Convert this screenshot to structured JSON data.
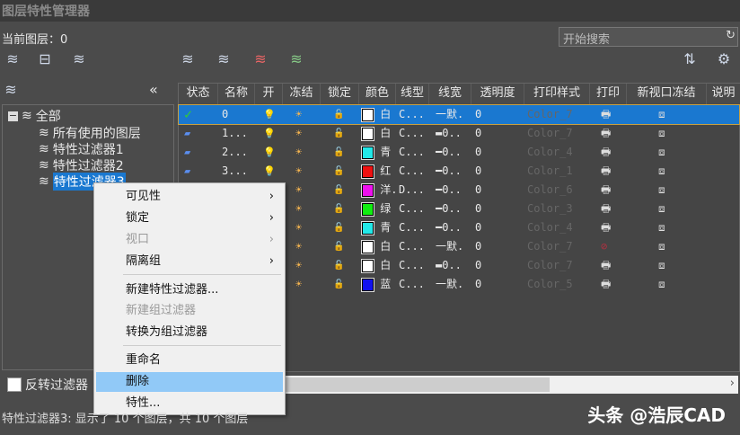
{
  "title": "图层特性管理器",
  "current_layer": "当前图层：0",
  "search": {
    "placeholder": "开始搜索"
  },
  "tree": {
    "root": "全部",
    "items": [
      "所有使用的图层",
      "特性过滤器1",
      "特性过滤器2",
      "特性过滤器3"
    ],
    "selected": "特性过滤器3"
  },
  "columns": [
    "状态",
    "名称",
    "开",
    "冻结",
    "锁定",
    "颜色",
    "线型",
    "线宽",
    "透明度",
    "打印样式",
    "打印",
    "新视口冻结",
    "说明"
  ],
  "rows": [
    {
      "name": "0",
      "color": "#ffffff",
      "color_name": "白",
      "linetype": "C...",
      "lineweight": "一默.",
      "transparency": "0",
      "plotstyle": "Color_7",
      "plot": true
    },
    {
      "name": "1...",
      "color": "#ffffff",
      "color_name": "白",
      "linetype": "C...",
      "lineweight": "▬0..",
      "transparency": "0",
      "plotstyle": "Color_7",
      "plot": true
    },
    {
      "name": "2...",
      "color": "#22e8e8",
      "color_name": "青",
      "linetype": "C...",
      "lineweight": "━0..",
      "transparency": "0",
      "plotstyle": "Color_4",
      "plot": true
    },
    {
      "name": "3...",
      "color": "#ee1111",
      "color_name": "红",
      "linetype": "C...",
      "lineweight": "━0..",
      "transparency": "0",
      "plotstyle": "Color_1",
      "plot": true
    },
    {
      "name": "",
      "color": "#ee11ee",
      "color_name": "洋.",
      "linetype": "D...",
      "lineweight": "━0..",
      "transparency": "0",
      "plotstyle": "Color_6",
      "plot": true
    },
    {
      "name": "",
      "color": "#11ee11",
      "color_name": "绿",
      "linetype": "C...",
      "lineweight": "━0..",
      "transparency": "0",
      "plotstyle": "Color_3",
      "plot": true
    },
    {
      "name": "",
      "color": "#22e8e8",
      "color_name": "青",
      "linetype": "C...",
      "lineweight": "━0..",
      "transparency": "0",
      "plotstyle": "Color_4",
      "plot": true
    },
    {
      "name": "",
      "color": "#ffffff",
      "color_name": "白",
      "linetype": "C...",
      "lineweight": "一默.",
      "transparency": "0",
      "plotstyle": "Color_7",
      "plot": false
    },
    {
      "name": "",
      "color": "#ffffff",
      "color_name": "白",
      "linetype": "C...",
      "lineweight": "▬0..",
      "transparency": "0",
      "plotstyle": "Color_7",
      "plot": true
    },
    {
      "name": "",
      "color": "#1111ee",
      "color_name": "蓝",
      "linetype": "C...",
      "lineweight": "一默.",
      "transparency": "0",
      "plotstyle": "Color_5",
      "plot": true
    }
  ],
  "menu": {
    "items": [
      {
        "label": "可见性",
        "submenu": true,
        "disabled": false
      },
      {
        "label": "锁定",
        "submenu": true,
        "disabled": false
      },
      {
        "label": "视口",
        "submenu": true,
        "disabled": true
      },
      {
        "label": "隔离组",
        "submenu": true,
        "disabled": false
      },
      {
        "label": "新建特性过滤器...",
        "disabled": false
      },
      {
        "label": "新建组过滤器",
        "disabled": true
      },
      {
        "label": "转换为组过滤器",
        "disabled": false
      },
      {
        "label": "重命名",
        "disabled": false
      },
      {
        "label": "删除",
        "disabled": false,
        "highlighted": true
      },
      {
        "label": "特性...",
        "disabled": false
      }
    ]
  },
  "invert_filter": "反转过滤器",
  "status": "特性过滤器3: 显示了 10 个图层，共 10 个图层",
  "watermark": "头条 @浩辰CAD",
  "colors": {
    "selection": "#1a78d0",
    "menu_highlight": "#91c9f7"
  }
}
